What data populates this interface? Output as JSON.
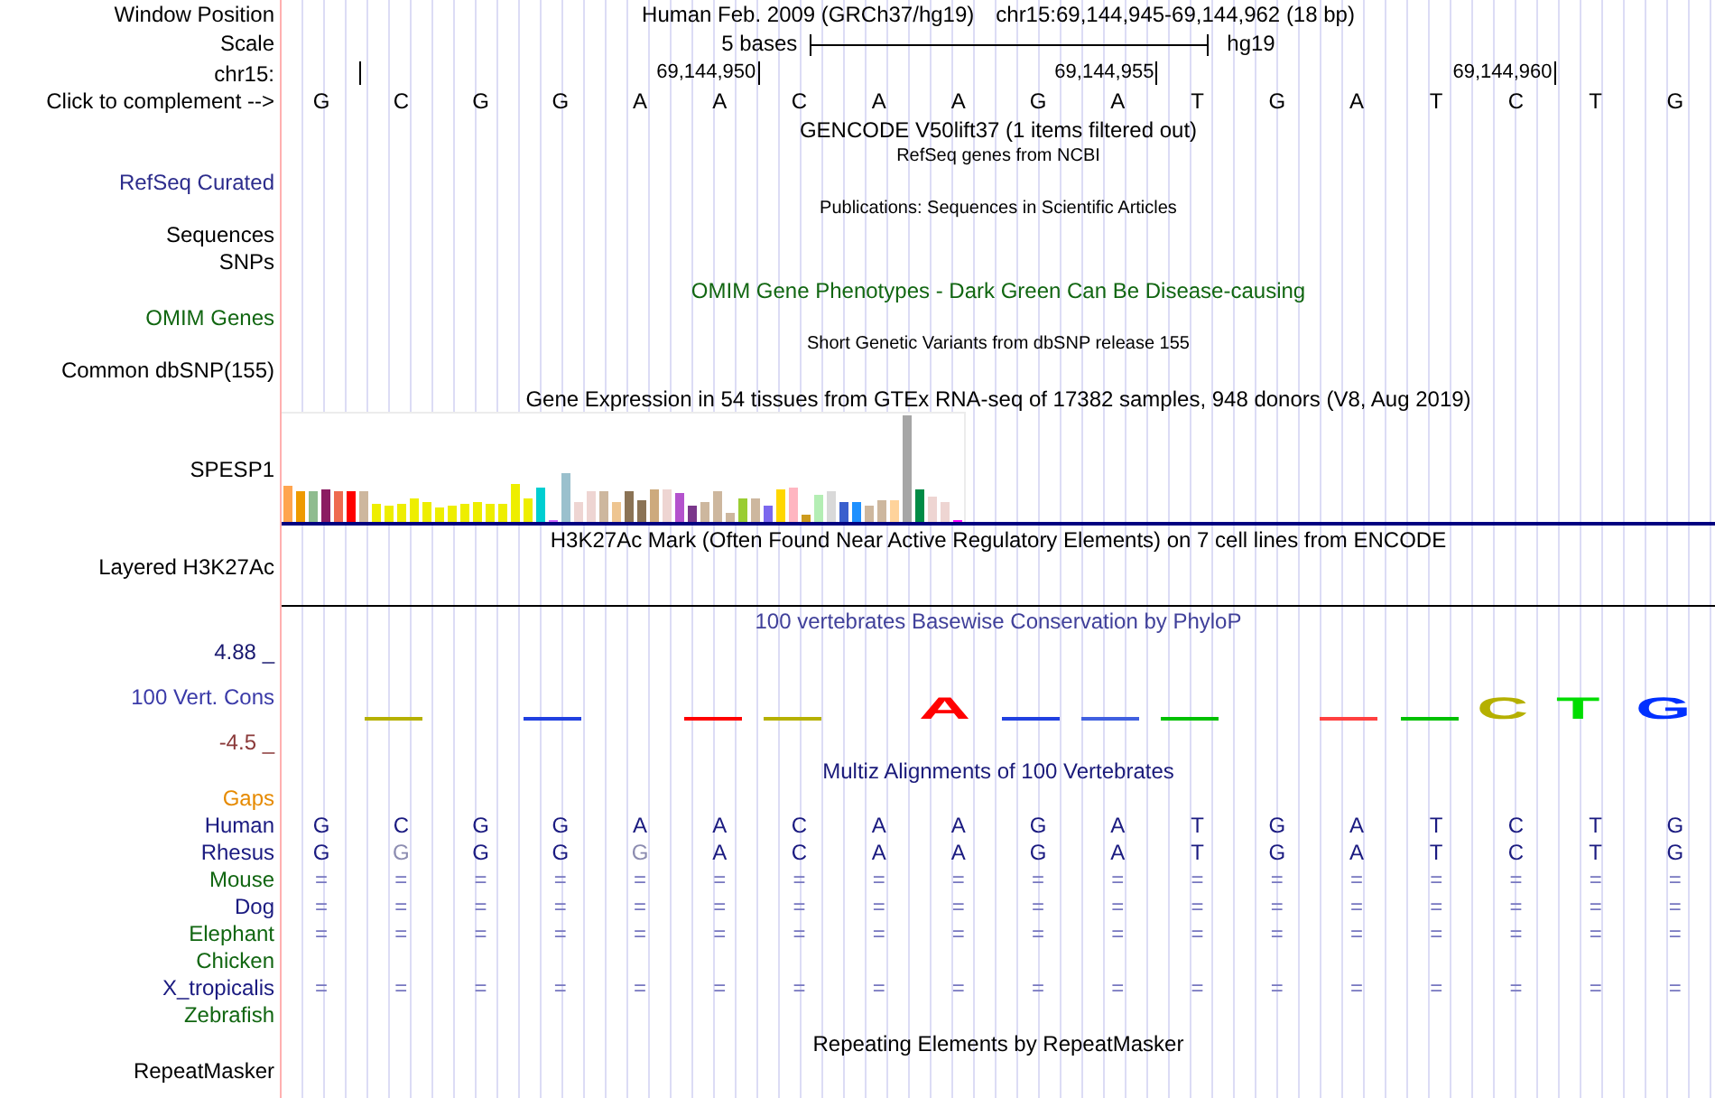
{
  "window_position": {
    "label": "Window Position",
    "assembly": "Human Feb. 2009 (GRCh37/hg19)",
    "range": "chr15:69,144,945-69,144,962 (18 bp)"
  },
  "scale": {
    "label": "Scale",
    "length": "5 bases",
    "database": "hg19"
  },
  "ruler": {
    "label": "chr15:",
    "ticks": [
      "69,144,950",
      "69,144,955",
      "69,144,960"
    ]
  },
  "sequence": {
    "label": "Click to complement -->",
    "bases": [
      "G",
      "C",
      "G",
      "G",
      "A",
      "A",
      "C",
      "A",
      "A",
      "G",
      "A",
      "T",
      "G",
      "A",
      "T",
      "C",
      "T",
      "G"
    ]
  },
  "tracks": [
    {
      "kind": "plain",
      "title": {
        "text": "GENCODE V50lift37 (1 items filtered out)",
        "kind": "heading",
        "color": "#000000"
      }
    },
    {
      "kind": "plain",
      "title": {
        "text": "RefSeq genes from NCBI",
        "kind": "note",
        "color": "#000000"
      },
      "labels": [
        {
          "text": "RefSeq Curated",
          "color": "#2c2c8c"
        }
      ]
    },
    {
      "kind": "plain",
      "title": {
        "text": "Publications: Sequences in Scientific Articles",
        "kind": "note",
        "color": "#000000"
      },
      "labels": [
        {
          "text": "Sequences",
          "color": "#000000"
        },
        {
          "text": "SNPs",
          "color": "#000000"
        }
      ]
    },
    {
      "kind": "plain",
      "title": {
        "text": "OMIM Gene Phenotypes - Dark Green Can Be Disease-causing",
        "kind": "heading",
        "color": "#116611"
      },
      "labels": [
        {
          "text": "OMIM Genes",
          "color": "#116611"
        }
      ]
    },
    {
      "kind": "plain",
      "title": {
        "text": "Short Genetic Variants from dbSNP release 155",
        "kind": "note",
        "color": "#000000"
      },
      "labels": [
        {
          "text": "Common dbSNP(155)",
          "color": "#000000"
        }
      ]
    },
    {
      "kind": "expression",
      "title": {
        "text": "Gene Expression in 54 tissues from GTEx RNA-seq of 17382 samples, 948 donors (V8, Aug 2019)",
        "kind": "heading",
        "color": "#000000"
      },
      "labels": [
        {
          "text": "SPESP1",
          "color": "#000000"
        }
      ]
    },
    {
      "kind": "layered",
      "title": {
        "text": "H3K27Ac Mark (Often Found Near Active Regulatory Elements) on 7 cell lines from ENCODE",
        "kind": "heading",
        "color": "#000000"
      },
      "labels": [
        {
          "text": "Layered H3K27Ac",
          "color": "#000000"
        }
      ]
    },
    {
      "kind": "conservation",
      "title": {
        "text": "100 vertebrates Basewise Conservation by PhyloP",
        "kind": "heading",
        "color": "#40409a"
      },
      "labels": [
        {
          "text": "4.88 _",
          "color": "#191970"
        },
        {
          "text": "100 Vert. Cons",
          "color": "#3a3aa8"
        },
        {
          "text": "-4.5 _",
          "color": "#8b3a3a"
        }
      ],
      "logo": [
        {
          "base": "A",
          "color": "#ff0000"
        },
        {
          "base": "C",
          "color": "#b5b000"
        },
        {
          "base": "T",
          "color": "#00dd00"
        },
        {
          "base": "G",
          "color": "#0030ff"
        }
      ]
    },
    {
      "kind": "alignment",
      "title": {
        "text": "Multiz Alignments of 100 Vertebrates",
        "kind": "heading",
        "color": "#1a1a7a"
      },
      "labels": [
        {
          "text": "Gaps",
          "color": "#e68a00"
        }
      ],
      "species": [
        {
          "name": "Human",
          "color": "#1a1a80",
          "kind": "bases",
          "cells": [
            {
              "text": "G",
              "muted": false
            },
            {
              "text": "C",
              "muted": false
            },
            {
              "text": "G",
              "muted": false
            },
            {
              "text": "G",
              "muted": false
            },
            {
              "text": "A",
              "muted": false
            },
            {
              "text": "A",
              "muted": false
            },
            {
              "text": "C",
              "muted": false
            },
            {
              "text": "A",
              "muted": false
            },
            {
              "text": "A",
              "muted": false
            },
            {
              "text": "G",
              "muted": false
            },
            {
              "text": "A",
              "muted": false
            },
            {
              "text": "T",
              "muted": false
            },
            {
              "text": "G",
              "muted": false
            },
            {
              "text": "A",
              "muted": false
            },
            {
              "text": "T",
              "muted": false
            },
            {
              "text": "C",
              "muted": false
            },
            {
              "text": "T",
              "muted": false
            },
            {
              "text": "G",
              "muted": false
            }
          ]
        },
        {
          "name": "Rhesus",
          "color": "#1a1a80",
          "kind": "bases",
          "cells": [
            {
              "text": "G",
              "muted": false
            },
            {
              "text": "G",
              "muted": true
            },
            {
              "text": "G",
              "muted": false
            },
            {
              "text": "G",
              "muted": false
            },
            {
              "text": "G",
              "muted": true
            },
            {
              "text": "A",
              "muted": false
            },
            {
              "text": "C",
              "muted": false
            },
            {
              "text": "A",
              "muted": false
            },
            {
              "text": "A",
              "muted": false
            },
            {
              "text": "G",
              "muted": false
            },
            {
              "text": "A",
              "muted": false
            },
            {
              "text": "T",
              "muted": false
            },
            {
              "text": "G",
              "muted": false
            },
            {
              "text": "A",
              "muted": false
            },
            {
              "text": "T",
              "muted": false
            },
            {
              "text": "C",
              "muted": false
            },
            {
              "text": "T",
              "muted": false
            },
            {
              "text": "G",
              "muted": false
            }
          ]
        },
        {
          "name": "Mouse",
          "color": "#116611",
          "kind": "matches",
          "cells": [
            "=",
            "=",
            "=",
            "=",
            "=",
            "=",
            "=",
            "=",
            "=",
            "=",
            "=",
            "=",
            "=",
            "=",
            "=",
            "=",
            "=",
            "="
          ]
        },
        {
          "name": "Dog",
          "color": "#1a1a80",
          "kind": "matches",
          "cells": [
            "=",
            "=",
            "=",
            "=",
            "=",
            "=",
            "=",
            "=",
            "=",
            "=",
            "=",
            "=",
            "=",
            "=",
            "=",
            "=",
            "=",
            "="
          ]
        },
        {
          "name": "Elephant",
          "color": "#116611",
          "kind": "matches",
          "cells": [
            "=",
            "=",
            "=",
            "=",
            "=",
            "=",
            "=",
            "=",
            "=",
            "=",
            "=",
            "=",
            "=",
            "=",
            "=",
            "=",
            "=",
            "="
          ]
        },
        {
          "name": "Chicken",
          "color": "#116611",
          "kind": "matches"
        },
        {
          "name": "X_tropicalis",
          "color": "#1a1a80",
          "kind": "matches",
          "cells": [
            "=",
            "=",
            "=",
            "=",
            "=",
            "=",
            "=",
            "=",
            "=",
            "=",
            "=",
            "=",
            "=",
            "=",
            "=",
            "=",
            "=",
            "="
          ]
        },
        {
          "name": "Zebrafish",
          "color": "#116611",
          "kind": "matches"
        }
      ]
    },
    {
      "kind": "plain",
      "title": {
        "text": "Repeating Elements by RepeatMasker",
        "kind": "heading",
        "color": "#000000"
      },
      "labels": [
        {
          "text": "RepeatMasker",
          "color": "#000000"
        }
      ]
    }
  ]
}
